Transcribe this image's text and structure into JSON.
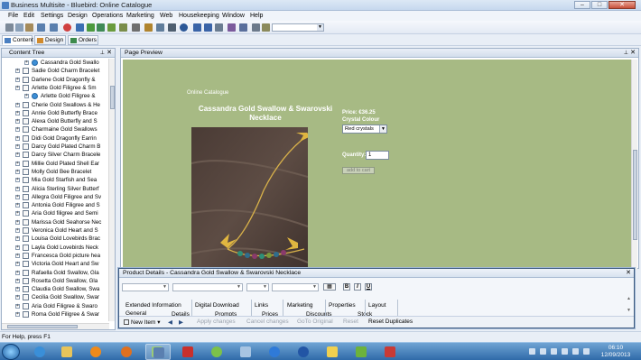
{
  "window": {
    "title": "Business Multisite - Bluebird: Online Catalogue"
  },
  "menu": [
    "File",
    "Edit",
    "Settings",
    "Design",
    "Operations",
    "Marketing",
    "Web",
    "Housekeeping",
    "Window",
    "Help"
  ],
  "view_tabs": [
    {
      "label": "Content"
    },
    {
      "label": "Design"
    },
    {
      "label": "Orders"
    }
  ],
  "content_tree": {
    "title": "Content Tree",
    "items": [
      "Cassandra Gold Swallo",
      "Sadie Gold Charm Bracelet",
      "Darlene Gold Dragonfly &",
      "Arlette Gold Filigree & Sm",
      "Arlette Gold Filigree &",
      "Cherie Gold Swallows & He",
      "Annie Gold Butterfly Brace",
      "Alexa Gold Butterfly and S",
      "Charmaine Gold Swallows",
      "Didi Gold Dragonfly Earrin",
      "Darcy Gold Plated Charm B",
      "Darcy Silver Charm Bracele",
      "Millie Gold Plated Shell Ear",
      "Molly Gold Bee Bracelet",
      "Mia Gold  Starfish and Sea",
      "Alicia Sterling Silver Butterf",
      "Allegra Gold Filigree and Sv",
      "Antonia Gold Filigree and S",
      "Aria Gold filigree and Semi",
      "Marissa Gold Seahorse Nec",
      "Veronica Gold Heart and S",
      "Louisa Gold Lovebirds Brac",
      "Layla Gold Lovebirds Neck",
      "Francesca Gold picture hea",
      "Victoria Gold Heart and Sw",
      "Rafaella Gold Swallow, Gla",
      "Rosetta Gold Swallow, Gla",
      "Claudia Gold Swallow, Swa",
      "Cecilia Gold Swallow, Swar",
      "Aria Gold Filigree & Swaro",
      "Roma Gold Filigree & Swar"
    ]
  },
  "preview": {
    "title": "Page Preview",
    "brand": "Online Catalogue",
    "product_title": "Cassandra Gold Swallow & Swarovski Necklace",
    "price": "Price: €36.25",
    "colour_label": "Crystal Colour",
    "colour_value": "Red crystals",
    "quantity_label": "Quantity:",
    "quantity_value": "1",
    "cart_button": "add to cart",
    "background_color": "#a7ba84"
  },
  "details": {
    "title": "Product Details - Cassandra Gold Swallow & Swarovski Necklace",
    "format_buttons": [
      "B",
      "I",
      "U"
    ],
    "tabs_row1": [
      "Extended Information",
      "Digital Download",
      "Links",
      "Marketing",
      "Properties",
      "Layout"
    ],
    "tabs_row2": [
      "General",
      "Details",
      "Prompts",
      "Prices",
      "Discounts",
      "Stock"
    ],
    "footer": {
      "new_item": "New Item",
      "apply": "Apply changes",
      "cancel": "Cancel changes",
      "goto": "GoTo Original",
      "reset": "Reset",
      "reset_duplicates": "Reset Duplicates"
    }
  },
  "status": {
    "text": "For Help, press F1"
  },
  "clock": {
    "time": "06:10",
    "date": "12/09/2013"
  }
}
